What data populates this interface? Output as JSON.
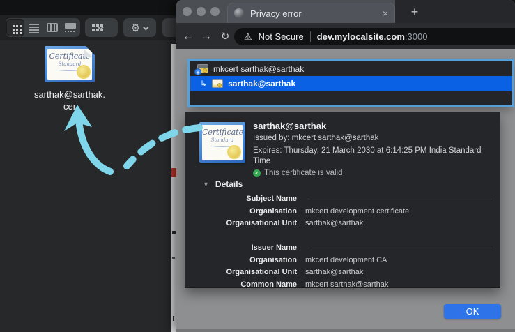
{
  "finder": {
    "toolbar": {
      "view_modes": [
        "icon-view",
        "list-view",
        "column-view",
        "gallery-view"
      ],
      "actions_glyph": "⚙"
    },
    "file": {
      "name_line1": "sarthak@sarthak.",
      "name_line2": "cer"
    }
  },
  "certificate_icon": {
    "line1": "Certificate",
    "line2": "Standard"
  },
  "browser": {
    "tab": {
      "title": "Privacy error",
      "close_glyph": "×",
      "new_tab_glyph": "+"
    },
    "nav": {
      "back_glyph": "←",
      "forward_glyph": "→",
      "reload_glyph": "↻"
    },
    "omnibox": {
      "warning_glyph": "⚠",
      "security_label": "Not Secure",
      "host": "dev.mylocalsite.com",
      "port": ":3000"
    }
  },
  "cert_dialog": {
    "chain": [
      {
        "label": "mkcert sarthak@sarthak"
      },
      {
        "label": "sarthak@sarthak"
      }
    ],
    "chain_return_glyph": "↳",
    "summary": {
      "name": "sarthak@sarthak",
      "issued_by": "Issued by: mkcert sarthak@sarthak",
      "expires": "Expires: Thursday, 21 March 2030 at 6:14:25 PM India Standard Time",
      "valid_glyph": "✓",
      "valid_text": "This certificate is valid"
    },
    "details": {
      "disclosure_glyph": "▼",
      "header": "Details",
      "sections": [
        {
          "title": "Subject Name",
          "rows": [
            [
              "Organisation",
              "mkcert development certificate"
            ],
            [
              "Organisational Unit",
              "sarthak@sarthak"
            ]
          ]
        },
        {
          "title": "Issuer Name",
          "rows": [
            [
              "Organisation",
              "mkcert development CA"
            ],
            [
              "Organisational Unit",
              "sarthak@sarthak"
            ],
            [
              "Common Name",
              "mkcert sarthak@sarthak"
            ]
          ]
        }
      ]
    },
    "ok_label": "OK"
  },
  "colors": {
    "selection_blue": "#0b61e4",
    "ok_blue": "#2e74e8",
    "valid_green": "#35a852",
    "focus_ring": "#55a0da",
    "arrow_cyan": "#7fd6ea"
  }
}
